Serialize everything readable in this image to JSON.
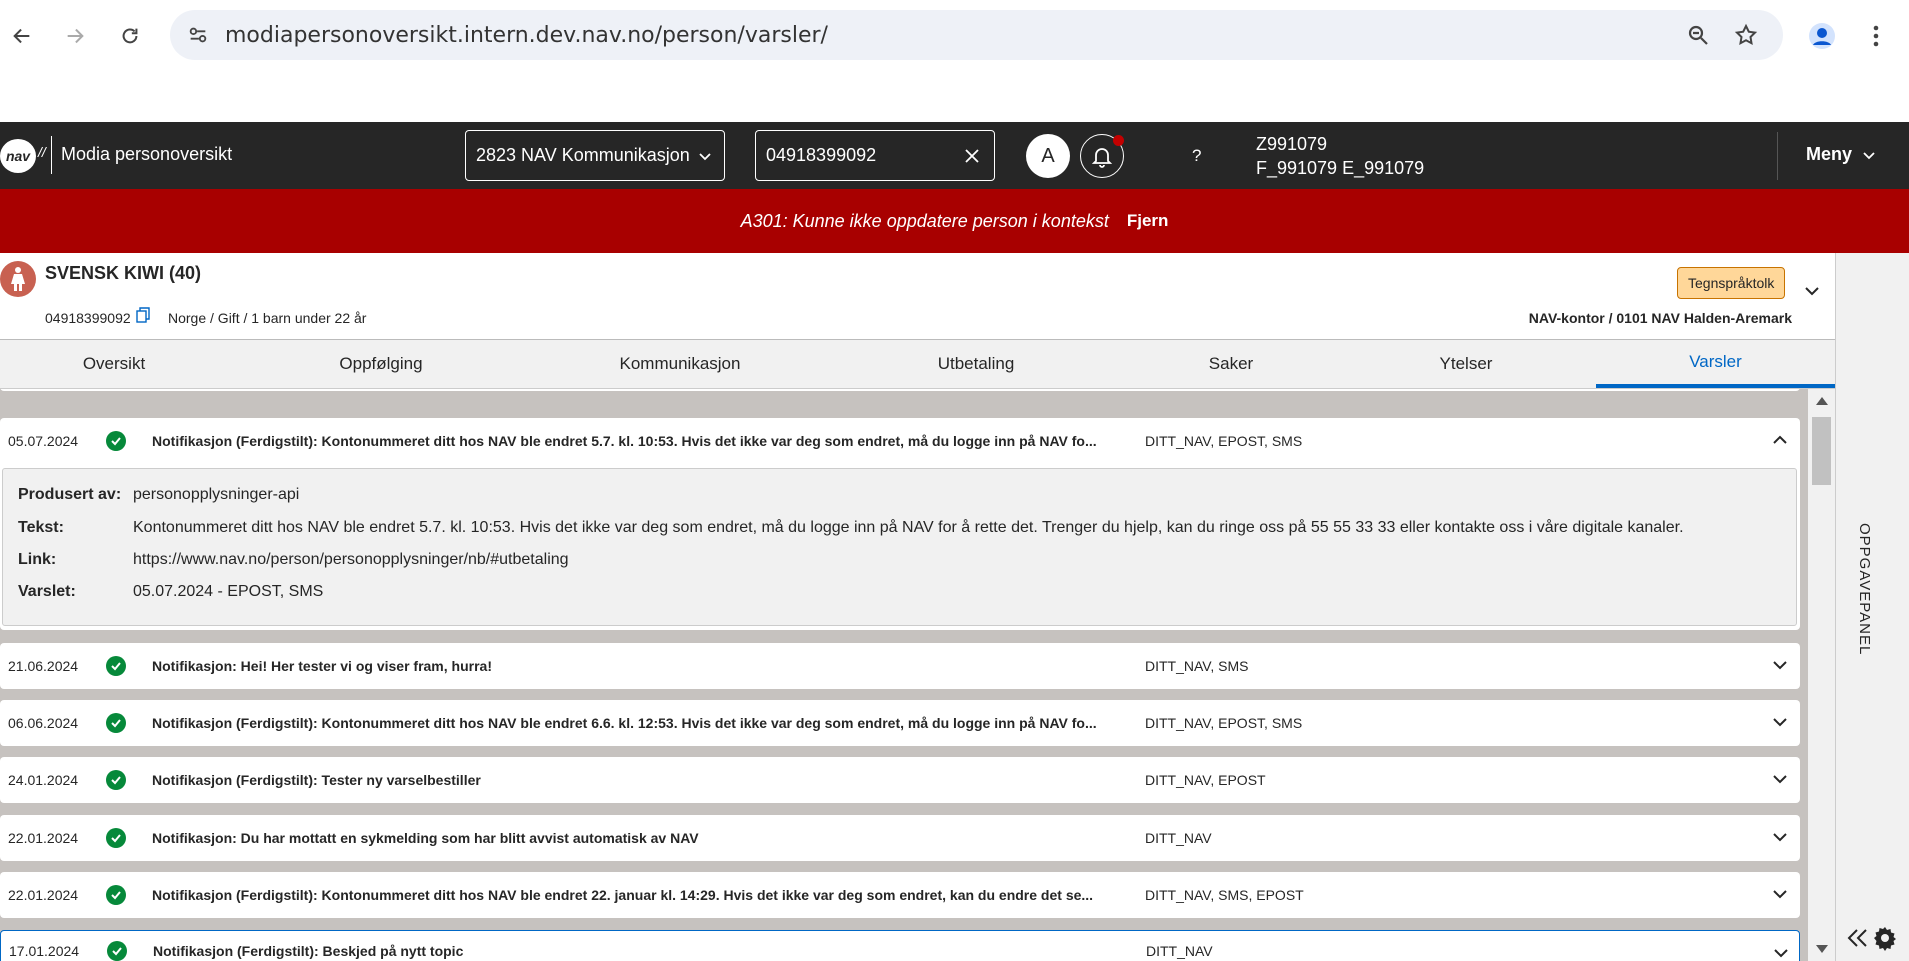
{
  "browser": {
    "url": "modiapersonoversikt.intern.dev.nav.no/person/varsler/"
  },
  "appbar": {
    "logo": "nav",
    "logo_suffix": "//",
    "title": "Modia personoversikt",
    "enhet": "2823 NAV Kommunikasjon",
    "search_value": "04918399092",
    "avatar_letter": "A",
    "help": "?",
    "user_id": "Z991079",
    "user_name": "F_991079 E_991079",
    "menu_label": "Meny"
  },
  "error": {
    "message": "A301: Kunne ikke oppdatere person i kontekst",
    "remove_label": "Fjern"
  },
  "person": {
    "name": "SVENSK KIWI (40)",
    "fnr": "04918399092",
    "status": "Norge / Gift / 1 barn under 22 år",
    "badge": "Tegnspråktolk",
    "office": "NAV-kontor / 0101 NAV Halden-Aremark"
  },
  "tabs": [
    {
      "label": "Oversikt"
    },
    {
      "label": "Oppfølging"
    },
    {
      "label": "Kommunikasjon"
    },
    {
      "label": "Utbetaling"
    },
    {
      "label": "Saker"
    },
    {
      "label": "Ytelser"
    },
    {
      "label": "Varsler"
    }
  ],
  "active_tab": "Varsler",
  "expanded": {
    "date": "05.07.2024",
    "title": "Notifikasjon (Ferdigstilt): Kontonummeret ditt hos NAV ble endret 5.7. kl. 10:53. Hvis det ikke var deg som endret, må du logge inn på NAV fo...",
    "channels": "DITT_NAV,  EPOST,  SMS",
    "labels": {
      "produsert": "Produsert av:",
      "tekst": "Tekst:",
      "link": "Link:",
      "varslet": "Varslet:"
    },
    "produsert": "personopplysninger-api",
    "tekst": "Kontonummeret ditt hos NAV ble endret 5.7. kl. 10:53. Hvis det ikke var deg som endret, må du logge inn på NAV for å rette det. Trenger du hjelp, kan du ringe oss på 55 55 33 33 eller kontakte oss i våre digitale kanaler.",
    "link": "https://www.nav.no/person/personopplysninger/nb/#utbetaling",
    "varslet": "05.07.2024 - EPOST, SMS"
  },
  "rows": [
    {
      "date": "21.06.2024",
      "title": "Notifikasjon: Hei! Her tester vi og viser fram, hurra!",
      "channels": "DITT_NAV,  SMS"
    },
    {
      "date": "06.06.2024",
      "title": "Notifikasjon (Ferdigstilt): Kontonummeret ditt hos NAV ble endret 6.6. kl. 12:53. Hvis det ikke var deg som endret, må du logge inn på NAV fo...",
      "channels": "DITT_NAV,  EPOST,  SMS"
    },
    {
      "date": "24.01.2024",
      "title": "Notifikasjon (Ferdigstilt): Tester ny varselbestiller",
      "channels": "DITT_NAV,  EPOST"
    },
    {
      "date": "22.01.2024",
      "title": "Notifikasjon: Du har mottatt en sykmelding som har blitt avvist automatisk av NAV",
      "channels": "DITT_NAV"
    },
    {
      "date": "22.01.2024",
      "title": "Notifikasjon (Ferdigstilt): Kontonummeret ditt hos NAV ble endret 22. januar kl. 14:29. Hvis det ikke var deg som endret, kan du endre det se...",
      "channels": "DITT_NAV,  SMS,  EPOST"
    },
    {
      "date": "17.01.2024",
      "title": "Notifikasjon (Ferdigstilt): Beskjed på nytt topic",
      "channels": "DITT_NAV"
    }
  ],
  "side_panel": {
    "label": "OPPGAVEPANEL"
  },
  "colors": {
    "appbar": "#262626",
    "error": "#a80000",
    "active_tab": "#0067c5",
    "success": "#06893a",
    "badge": "#ffd799"
  }
}
